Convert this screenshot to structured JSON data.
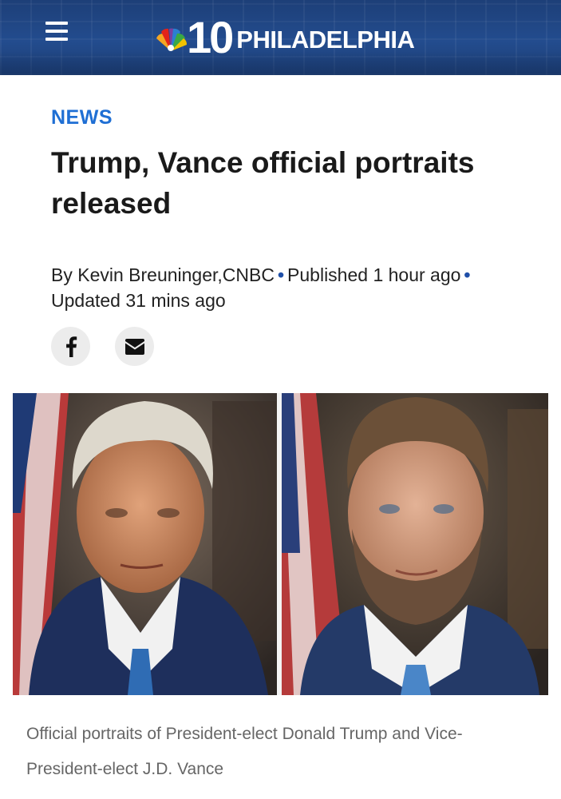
{
  "header": {
    "menu_icon": "hamburger-menu-icon",
    "logo": {
      "number": "10",
      "city": "PHILADELPHIA",
      "mark": "nbc-peacock-icon"
    }
  },
  "article": {
    "category": "NEWS",
    "headline": "Trump, Vance official portraits released",
    "byline": {
      "author": "By Kevin Breuninger,CNBC",
      "published": "Published 1 hour ago",
      "updated": "Updated 31 mins ago"
    },
    "share": [
      {
        "name": "facebook",
        "icon": "facebook-icon"
      },
      {
        "name": "email",
        "icon": "email-icon"
      }
    ],
    "image_caption": "Official portraits of President-elect Donald Trump and Vice-President-elect J.D. Vance"
  },
  "colors": {
    "header_bg": "#234c8e",
    "category": "#1f6fd4",
    "byline_dot": "#1f4fa8",
    "caption": "#666666"
  }
}
